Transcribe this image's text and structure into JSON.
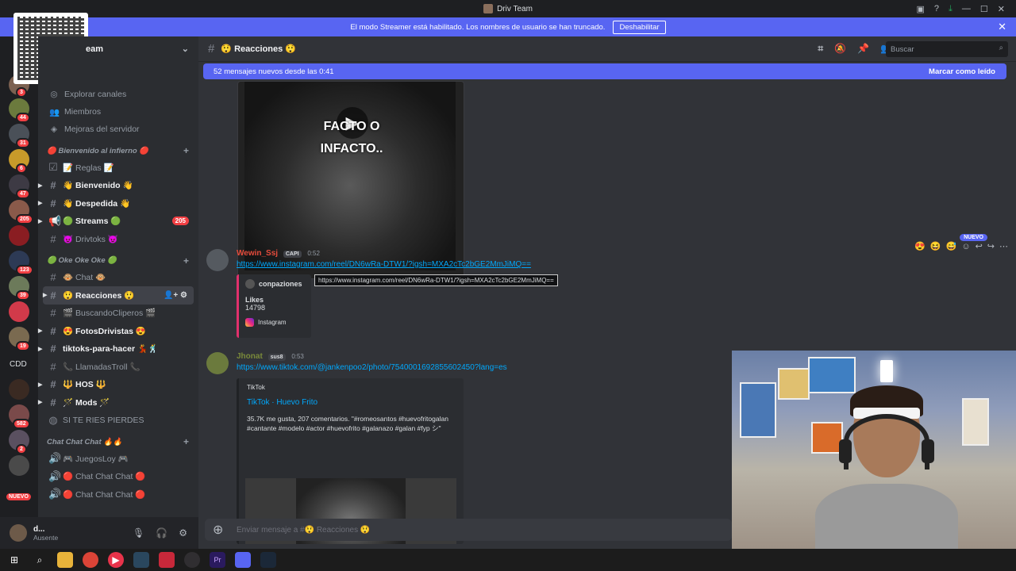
{
  "window": {
    "title": "Driv Team"
  },
  "banner": {
    "text": "El modo Streamer está habilitado. Los nombres de usuario se han truncado.",
    "button": "Deshabilitar"
  },
  "guild_badges": [
    "3",
    "44",
    "31",
    "6",
    "47",
    "205",
    "123",
    "39",
    "19",
    "582",
    "2",
    "NUEVO"
  ],
  "guild_text": "CDD",
  "server": {
    "name": "eam"
  },
  "nav": [
    {
      "icon": "compass-icon",
      "label": "Explorar canales"
    },
    {
      "icon": "members-icon",
      "label": "Miembros"
    },
    {
      "icon": "boost-icon",
      "label": "Mejoras del servidor"
    }
  ],
  "categories": [
    {
      "name": "🔴 Bienvenido al infierno 🔴",
      "channels": [
        {
          "label": "📝 Reglas 📝",
          "icon": "rules-icon",
          "bold": false
        },
        {
          "label": "👋 Bienvenido 👋",
          "icon": "hash-icon",
          "bold": true,
          "caret": true
        },
        {
          "label": "👋 Despedida 👋",
          "icon": "hash-icon",
          "bold": true,
          "caret": true
        },
        {
          "label": "🟢 Streams 🟢",
          "icon": "announce-icon",
          "bold": true,
          "caret": true,
          "badge": "205"
        },
        {
          "label": "😈 Drivtoks 😈",
          "icon": "hash-icon",
          "bold": false
        }
      ]
    },
    {
      "name": "🟢 Oke Oke Oke 🟢",
      "channels": [
        {
          "label": "🐵 Chat 🐵",
          "icon": "hash-icon",
          "bold": false
        },
        {
          "label": "😲 Reacciones 😲",
          "icon": "hash-icon",
          "bold": true,
          "active": true,
          "caret": true
        },
        {
          "label": "🎬 BuscandoCliperos 🎬",
          "icon": "hash-icon",
          "bold": false
        },
        {
          "label": "😍 FotosDrivistas 😍",
          "icon": "hash-icon",
          "bold": true,
          "caret": true
        },
        {
          "label": "tiktoks-para-hacer 💃🕺",
          "icon": "hash-icon",
          "bold": true,
          "caret": true
        },
        {
          "label": "📞 LlamadasTroll 📞",
          "icon": "hash-icon",
          "bold": false
        },
        {
          "label": "🔱 HOS 🔱",
          "icon": "hash-icon",
          "bold": true,
          "caret": true
        },
        {
          "label": "🪄 Mods 🪄",
          "icon": "hash-icon",
          "bold": true,
          "caret": true
        },
        {
          "label": "SI TE RIES PIERDES",
          "icon": "forum-icon",
          "bold": false
        }
      ]
    },
    {
      "name": "Chat Chat Chat 🔥🔥",
      "channels": [
        {
          "label": "🎮 JuegosLoy 🎮",
          "icon": "voice-icon",
          "bold": false
        },
        {
          "label": "🔴 Chat Chat Chat 🔴",
          "icon": "voice-icon",
          "bold": false
        },
        {
          "label": "🔴 Chat Chat Chat 🔴",
          "icon": "voice-icon",
          "bold": false
        }
      ]
    }
  ],
  "user": {
    "name": "d...",
    "status": "Ausente"
  },
  "channel": {
    "name": "😲 Reacciones 😲",
    "search_placeholder": "Buscar"
  },
  "newbar": {
    "text": "52 mensajes nuevos desde las 0:41",
    "mark": "Marcar como leído"
  },
  "video_caption": [
    "FACTO O",
    "INFACTO.."
  ],
  "messages": [
    {
      "author": "Wewin_Ssj",
      "tag": "CAPI",
      "time": "0:52",
      "author_color": "#e74c3c",
      "link": "https://www.instagram.com/reel/DN6wRa-DTW1/?igsh=MXA2cTc2bGE2MmJiMQ==",
      "tooltip": "https://www.instagram.com/reel/DN6wRa-DTW1/?igsh=MXA2cTc2bGE2MmJiMQ==",
      "embed": {
        "author": "conpaziones",
        "title": "Likes",
        "value": "14798",
        "provider": "Instagram"
      }
    },
    {
      "author": "Jhonat",
      "tag": "sus8",
      "time": "0:53",
      "author_color": "#7a8a3a",
      "link": "https://www.tiktok.com/@jankenpoo2/photo/7540001692855602450?lang=es",
      "embed": {
        "provider": "TikTok",
        "title": "TikTok · Huevo Frito",
        "description": "35.7K me gusta, 207 comentarios. \"#romeosantos #huevofritogalan #cantante #modelo #actor #huevofrito #galanazo #galan #fyp シ\""
      }
    }
  ],
  "nuevo_label": "NUEVO",
  "composer": {
    "placeholder": "Enviar mensaje a #😲 Reacciones 😲"
  },
  "colors": {
    "accent": "#5865f2",
    "bg": "#313338",
    "sidebar": "#2b2d31",
    "link": "#00a8fc"
  }
}
